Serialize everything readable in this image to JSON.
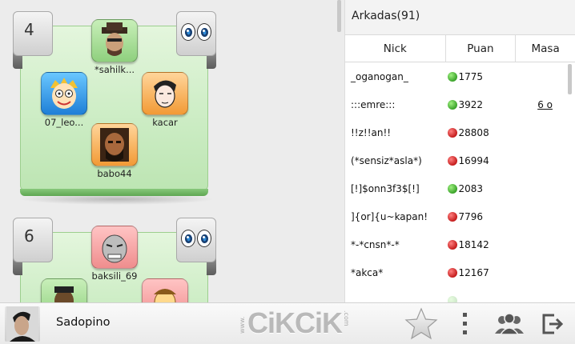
{
  "lobby": {
    "tables": [
      {
        "number": "4",
        "seats": [
          {
            "name": "*sahilk...",
            "color": "green"
          },
          {
            "name": "07_leo...",
            "color": "blue"
          },
          {
            "name": "kacar",
            "color": "orange"
          },
          {
            "name": "babo44",
            "color": "orange"
          }
        ]
      },
      {
        "number": "6",
        "seats": [
          {
            "name": "baksili_69",
            "color": "red"
          },
          {
            "name": "",
            "color": "green"
          },
          {
            "name": "",
            "color": "red"
          }
        ]
      }
    ]
  },
  "friends": {
    "header": "Arkadas(91)",
    "columns": {
      "nick": "Nick",
      "puan": "Puan",
      "masa": "Masa"
    },
    "rows": [
      {
        "nick": "_oganogan_",
        "status": "green",
        "puan": "1775",
        "masa": ""
      },
      {
        "nick": ":::emre:::",
        "status": "green",
        "puan": "3922",
        "masa": "6 o"
      },
      {
        "nick": "!!z!!an!!",
        "status": "red",
        "puan": "28808",
        "masa": ""
      },
      {
        "nick": "(*sensiz*asla*)",
        "status": "red",
        "puan": "16994",
        "masa": ""
      },
      {
        "nick": "[!]$onn3f3$[!]",
        "status": "green",
        "puan": "2083",
        "masa": ""
      },
      {
        "nick": "]{or]{u~kapan!",
        "status": "red",
        "puan": "7796",
        "masa": ""
      },
      {
        "nick": "*-*cnsn*-*",
        "status": "red",
        "puan": "18142",
        "masa": ""
      },
      {
        "nick": "*akca*",
        "status": "red",
        "puan": "12167",
        "masa": ""
      }
    ]
  },
  "bottombar": {
    "username": "Sadopino",
    "logo": "CiKCiK",
    "logo_prefix": "www.",
    "logo_suffix": ".com",
    "icons": [
      "star-icon",
      "more-vert-icon",
      "friends-icon",
      "logout-icon"
    ]
  },
  "colors": {
    "online": "#3aa22a",
    "busy": "#c41c1c",
    "felt": "#cbecc3"
  }
}
